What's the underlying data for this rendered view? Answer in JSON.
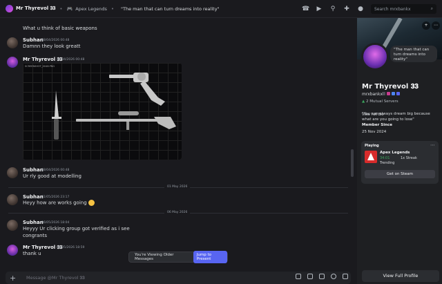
{
  "header": {
    "user_name": "Mr Thyrevol 𝟑𝟑",
    "game_name": "Apex Legends",
    "status": "\"The man that can turn dreams into reality\"",
    "search_placeholder": "Search mrxbankx"
  },
  "messages": [
    {
      "author": "",
      "time": "",
      "text": "What u think of basic weapons"
    },
    {
      "author": "Subhan",
      "time": "28/04/2026 00:48",
      "text": "Damnn they look greatt"
    },
    {
      "author": "Mr Thyrevol 𝟑𝟑",
      "time": "28/04/2026 00:48",
      "text": ""
    },
    {
      "author": "Subhan",
      "time": "28/04/2026 00:48",
      "text": "Ur rly good at modelling"
    },
    {
      "author": "Subhan",
      "time": "01/05/2026 23:17",
      "text": "Heyy how are works going"
    },
    {
      "author": "Subhan",
      "time": "06/05/2026 18:04",
      "text": "Heyyy Ur clicking group got verified as i see"
    },
    {
      "author": "",
      "time": "",
      "text": "congrants"
    },
    {
      "author": "Mr Thyrevol 𝟑𝟑",
      "time": "06/05/2026 18:59",
      "text": "thank u"
    }
  ],
  "dividers": [
    "01 May 2026",
    "06 May 2026"
  ],
  "attachment_label": "SCREENSHOT_0048.PNG",
  "older_bar": {
    "text": "You're Viewing Older Messages",
    "button": "Jump to Present"
  },
  "composer": {
    "placeholder": "Message @Mr Thyrevol 𝟑𝟑"
  },
  "profile": {
    "bubble": "\"The man that can turn dreams into reality\"",
    "name": "Mr Thyrevol 𝟑𝟑",
    "handle": "mrxbankx",
    "mutual": "2 Mutual Servers",
    "bio": "\"You can always dream big because what are you going to lose\"",
    "bio_dash": "-",
    "view_bio": "View Full Bio",
    "member_since_label": "Member Since",
    "member_since": "25 Nov 2024",
    "playing_label": "Playing",
    "game": "Apex Legends",
    "game_time": "34:01",
    "streak": "1x Streak",
    "trending": "Trending",
    "steam_button": "Get on Steam",
    "full_profile": "View Full Profile"
  },
  "colors": {
    "accent": "#5865f2",
    "background": "#1a1a1e",
    "panel": "#1e1f22",
    "online": "#3ba55c",
    "apex": "#d72b2b"
  }
}
